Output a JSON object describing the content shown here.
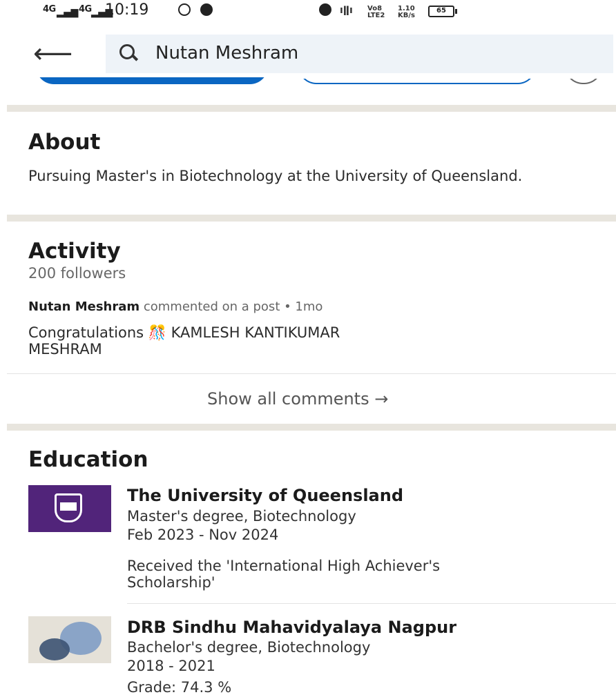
{
  "status_bar": {
    "signal_1": "4G",
    "signal_2": "4G",
    "time": "10:19",
    "volte": "Vo8 LTE2",
    "speed": "1.10 KB/s",
    "battery": "65"
  },
  "header": {
    "back_icon": "back-arrow-icon",
    "search_query": "Nutan Meshram"
  },
  "about": {
    "title": "About",
    "text": "Pursuing Master's in Biotechnology at the University of Queensland."
  },
  "activity": {
    "title": "Activity",
    "followers": "200 followers",
    "post_author": "Nutan Meshram",
    "post_meta": " commented on a post • 1mo",
    "post_text_1": "Congratulations 🎊 KAMLESH KANTIKUMAR",
    "post_text_2": "MESHRAM",
    "show_all": "Show all comments →"
  },
  "education": {
    "title": "Education",
    "items": [
      {
        "school": "The University of Queensland",
        "degree": "Master's degree, Biotechnology",
        "dates": "Feb 2023 - Nov 2024",
        "note_1": "Received the 'International High Achiever's",
        "note_2": "Scholarship'"
      },
      {
        "school": "DRB Sindhu Mahavidyalaya Nagpur",
        "degree": "Bachelor's degree, Biotechnology",
        "dates": "2018 - 2021",
        "grade": "Grade: 74.3 %"
      }
    ]
  },
  "colors": {
    "accent": "#0a66c2",
    "divider": "#e8e5de",
    "uq_purple": "#51247a"
  }
}
